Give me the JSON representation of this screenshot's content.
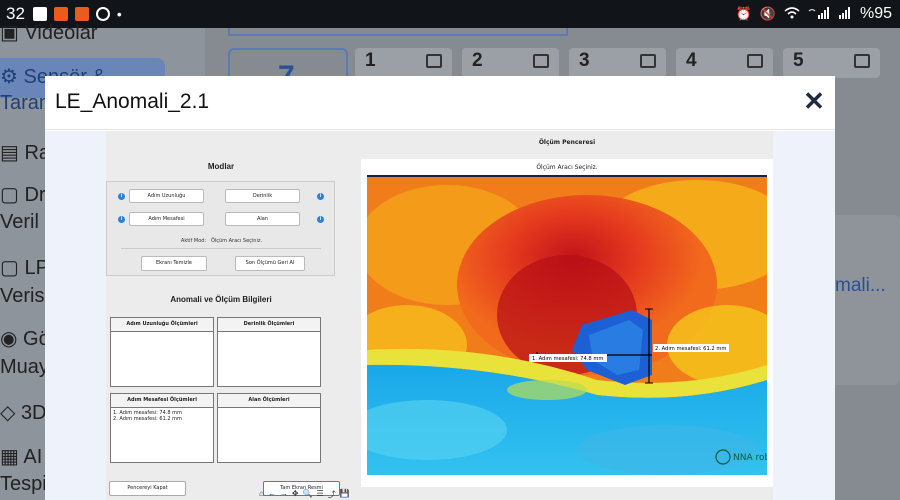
{
  "status_bar": {
    "time": "32",
    "battery": "%95",
    "dot": "•"
  },
  "background_app": {
    "sidebar_items": [
      "Videolar",
      "Sensör &",
      "Taram",
      "Rap",
      "Dr",
      "Veril",
      "LPS",
      "Verisi",
      "Gö",
      "Muay",
      "3D",
      "AI",
      "Tespit"
    ],
    "big_tab_number": "7",
    "tabs": [
      "1",
      "2",
      "3",
      "4",
      "5"
    ],
    "right_link": "mali..."
  },
  "modal": {
    "title": "LE_Anomali_2.1",
    "close_label": "✕"
  },
  "screenshot": {
    "modes_title": "Modlar",
    "mode_buttons": [
      "Adım Uzunluğu",
      "Derinlik",
      "Adım Mesafesi",
      "Alan"
    ],
    "active_mode_label": "Aktif Mod:",
    "active_mode_value": "Ölçüm Aracı Seçiniz.",
    "clear_button": "Ekranı Temizle",
    "undo_button": "Son Ölçümü Geri Al",
    "anomaly_title": "Anomali ve Ölçüm Bilgileri",
    "boxes": [
      {
        "title": "Adım Uzunluğu Ölçümleri",
        "lines": []
      },
      {
        "title": "Derinlik Ölçümleri",
        "lines": []
      },
      {
        "title": "Adım Mesafesi Ölçümleri",
        "lines": [
          "1. Adım mesafesi: 74.8 mm",
          "2. Adım mesafesi: 61.2 mm"
        ]
      },
      {
        "title": "Alan Ölçümleri",
        "lines": []
      }
    ],
    "close_window_button": "Pencereyi Kapat",
    "fullscreen_button": "Tam Ekran Resmi",
    "measure_window_title": "Ölçüm Penceresi",
    "measure_subtitle": "Ölçüm Aracı Seçiniz.",
    "annotations": [
      "1. Adım mesafesi: 74.8 mm",
      "2. Adım mesafesi: 61.2 mm"
    ],
    "watermark": "NNA robotics",
    "toolbar_icons": [
      "⌂",
      "←",
      "→",
      "✥",
      "🔍",
      "☰",
      "⤴",
      "💾"
    ]
  },
  "colors": {
    "accent": "#2f7fd6",
    "close": "#1e2a44",
    "statusbar": "#111418"
  }
}
